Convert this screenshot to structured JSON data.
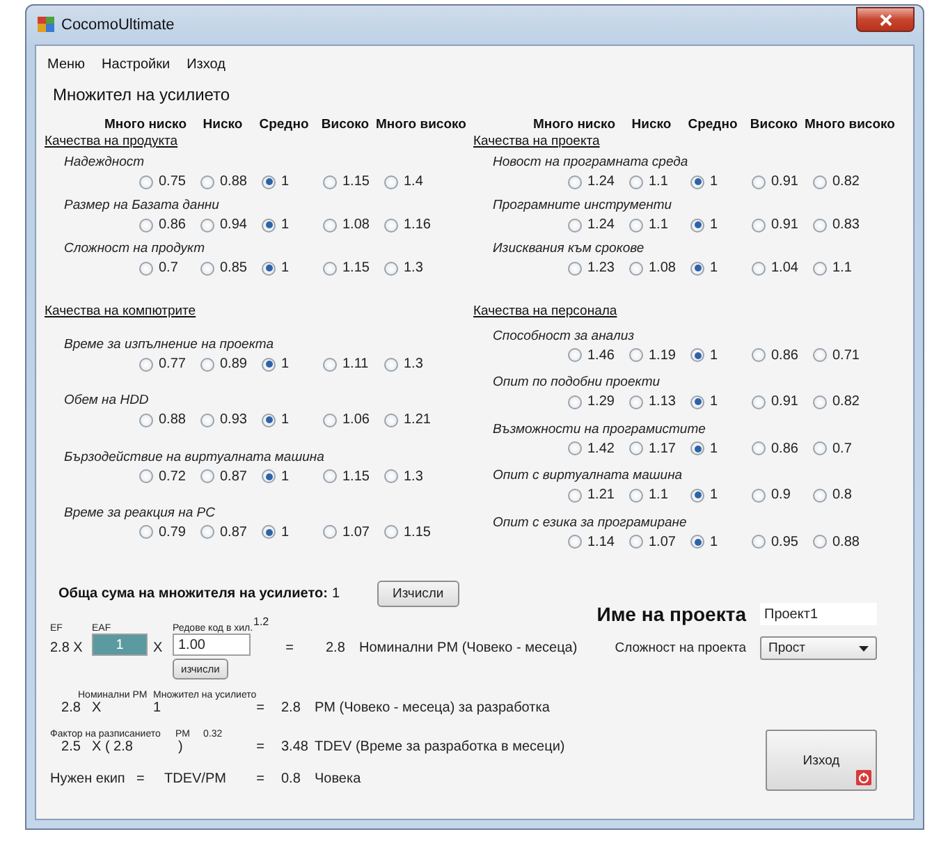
{
  "window": {
    "title": "CocomoUltimate"
  },
  "menu": [
    "Меню",
    "Настройки",
    "Изход"
  ],
  "section_title": "Множител на усилието",
  "panels": [
    {
      "headers": [
        "Много ниско",
        "Ниско",
        "Средно",
        "Високо",
        "Много високо"
      ],
      "groups": [
        {
          "title": "Качества на продукта",
          "factors": [
            {
              "name": "Надеждност",
              "options": [
                {
                  "value": "0.75",
                  "selected": false
                },
                {
                  "value": "0.88",
                  "selected": false
                },
                {
                  "value": "1",
                  "selected": true
                },
                {
                  "value": "1.15",
                  "selected": false
                },
                {
                  "value": "1.4",
                  "selected": false
                }
              ]
            },
            {
              "name": "Размер на Базата данни",
              "options": [
                {
                  "value": "0.86",
                  "selected": false
                },
                {
                  "value": "0.94",
                  "selected": false
                },
                {
                  "value": "1",
                  "selected": true
                },
                {
                  "value": "1.08",
                  "selected": false
                },
                {
                  "value": "1.16",
                  "selected": false
                }
              ]
            },
            {
              "name": "Сложност на продукт",
              "options": [
                {
                  "value": "0.7",
                  "selected": false
                },
                {
                  "value": "0.85",
                  "selected": false
                },
                {
                  "value": "1",
                  "selected": true
                },
                {
                  "value": "1.15",
                  "selected": false
                },
                {
                  "value": "1.3",
                  "selected": false
                }
              ]
            }
          ]
        },
        {
          "title": "Качества на компютрите",
          "factors": [
            {
              "name": "Време за изпълнение на проекта",
              "options": [
                {
                  "value": "0.77",
                  "selected": false
                },
                {
                  "value": "0.89",
                  "selected": false
                },
                {
                  "value": "1",
                  "selected": true
                },
                {
                  "value": "1.11",
                  "selected": false
                },
                {
                  "value": "1.3",
                  "selected": false
                }
              ]
            },
            {
              "name": "Обем на HDD",
              "options": [
                {
                  "value": "0.88",
                  "selected": false
                },
                {
                  "value": "0.93",
                  "selected": false
                },
                {
                  "value": "1",
                  "selected": true
                },
                {
                  "value": "1.06",
                  "selected": false
                },
                {
                  "value": "1.21",
                  "selected": false
                }
              ]
            },
            {
              "name": "Бързодействие на виртуалната машина",
              "options": [
                {
                  "value": "0.72",
                  "selected": false
                },
                {
                  "value": "0.87",
                  "selected": false
                },
                {
                  "value": "1",
                  "selected": true
                },
                {
                  "value": "1.15",
                  "selected": false
                },
                {
                  "value": "1.3",
                  "selected": false
                }
              ]
            },
            {
              "name": "Време за реакция на PC",
              "options": [
                {
                  "value": "0.79",
                  "selected": false
                },
                {
                  "value": "0.87",
                  "selected": false
                },
                {
                  "value": "1",
                  "selected": true
                },
                {
                  "value": "1.07",
                  "selected": false
                },
                {
                  "value": "1.15",
                  "selected": false
                }
              ]
            }
          ]
        }
      ]
    },
    {
      "headers": [
        "Много ниско",
        "Ниско",
        "Средно",
        "Високо",
        "Много високо"
      ],
      "groups": [
        {
          "title": "Качества на проекта",
          "factors": [
            {
              "name": "Новост на програмната среда",
              "options": [
                {
                  "value": "1.24",
                  "selected": false
                },
                {
                  "value": "1.1",
                  "selected": false
                },
                {
                  "value": "1",
                  "selected": true
                },
                {
                  "value": "0.91",
                  "selected": false
                },
                {
                  "value": "0.82",
                  "selected": false
                }
              ]
            },
            {
              "name": "Програмните инструменти",
              "options": [
                {
                  "value": "1.24",
                  "selected": false
                },
                {
                  "value": "1.1",
                  "selected": false
                },
                {
                  "value": "1",
                  "selected": true
                },
                {
                  "value": "0.91",
                  "selected": false
                },
                {
                  "value": "0.83",
                  "selected": false
                }
              ]
            },
            {
              "name": "Изисквания към срокове",
              "options": [
                {
                  "value": "1.23",
                  "selected": false
                },
                {
                  "value": "1.08",
                  "selected": false
                },
                {
                  "value": "1",
                  "selected": true
                },
                {
                  "value": "1.04",
                  "selected": false
                },
                {
                  "value": "1.1",
                  "selected": false
                }
              ]
            }
          ]
        },
        {
          "title": "Качества на персонала",
          "factors": [
            {
              "name": "Способност за анализ",
              "options": [
                {
                  "value": "1.46",
                  "selected": false
                },
                {
                  "value": "1.19",
                  "selected": false
                },
                {
                  "value": "1",
                  "selected": true
                },
                {
                  "value": "0.86",
                  "selected": false
                },
                {
                  "value": "0.71",
                  "selected": false
                }
              ]
            },
            {
              "name": "Опит по подобни проекти",
              "options": [
                {
                  "value": "1.29",
                  "selected": false
                },
                {
                  "value": "1.13",
                  "selected": false
                },
                {
                  "value": "1",
                  "selected": true
                },
                {
                  "value": "0.91",
                  "selected": false
                },
                {
                  "value": "0.82",
                  "selected": false
                }
              ]
            },
            {
              "name": "Възможности на програмистите",
              "options": [
                {
                  "value": "1.42",
                  "selected": false
                },
                {
                  "value": "1.17",
                  "selected": false
                },
                {
                  "value": "1",
                  "selected": true
                },
                {
                  "value": "0.86",
                  "selected": false
                },
                {
                  "value": "0.7",
                  "selected": false
                }
              ]
            },
            {
              "name": "Опит с виртуалната машина",
              "options": [
                {
                  "value": "1.21",
                  "selected": false
                },
                {
                  "value": "1.1",
                  "selected": false
                },
                {
                  "value": "1",
                  "selected": true
                },
                {
                  "value": "0.9",
                  "selected": false
                },
                {
                  "value": "0.8",
                  "selected": false
                }
              ]
            },
            {
              "name": "Опит с езика за програмиране",
              "options": [
                {
                  "value": "1.14",
                  "selected": false
                },
                {
                  "value": "1.07",
                  "selected": false
                },
                {
                  "value": "1",
                  "selected": true
                },
                {
                  "value": "0.95",
                  "selected": false
                },
                {
                  "value": "0.88",
                  "selected": false
                }
              ]
            }
          ]
        }
      ]
    }
  ],
  "summary": {
    "total_label": "Обща сума на множителя на усилието:",
    "total_value": "1",
    "calc_button": "Изчисли",
    "row1": {
      "label_ef": "EF",
      "label_eaf": "EAF",
      "label_loc": "Редове код в хил.",
      "exponent": "1.2",
      "ef": "2.8 X",
      "eaf": "1",
      "times": "X",
      "loc": "1.00",
      "eq": "=",
      "result": "2.8",
      "description": "Номинални PM (Човеко - месеца)",
      "small_button": "изчисли"
    },
    "row2": {
      "label_a": "Номинални PM",
      "label_b": "Множител на усилието",
      "a": "2.8",
      "times": "X",
      "b": "1",
      "eq": "=",
      "result": "2.8",
      "description": "PM (Човеко - месеца) за разработка"
    },
    "row3": {
      "label_a": "Фактор на разписанието",
      "label_b": "PM",
      "exponent": "0.32",
      "a": "2.5",
      "open": "X ( 2.8",
      "close": ")",
      "eq": "=",
      "result": "3.48",
      "description": "TDEV (Време за разработка в месеци)"
    },
    "row4": {
      "label": "Нужен екип",
      "eq1": "=",
      "formula": "TDEV/PM",
      "eq2": "=",
      "result": "0.8",
      "unit": "Човека"
    }
  },
  "project": {
    "name_label": "Име на проекта",
    "name_value": "Проект1",
    "complexity_label": "Сложност на проекта",
    "complexity_value": "Прост",
    "exit_button": "Изход"
  }
}
